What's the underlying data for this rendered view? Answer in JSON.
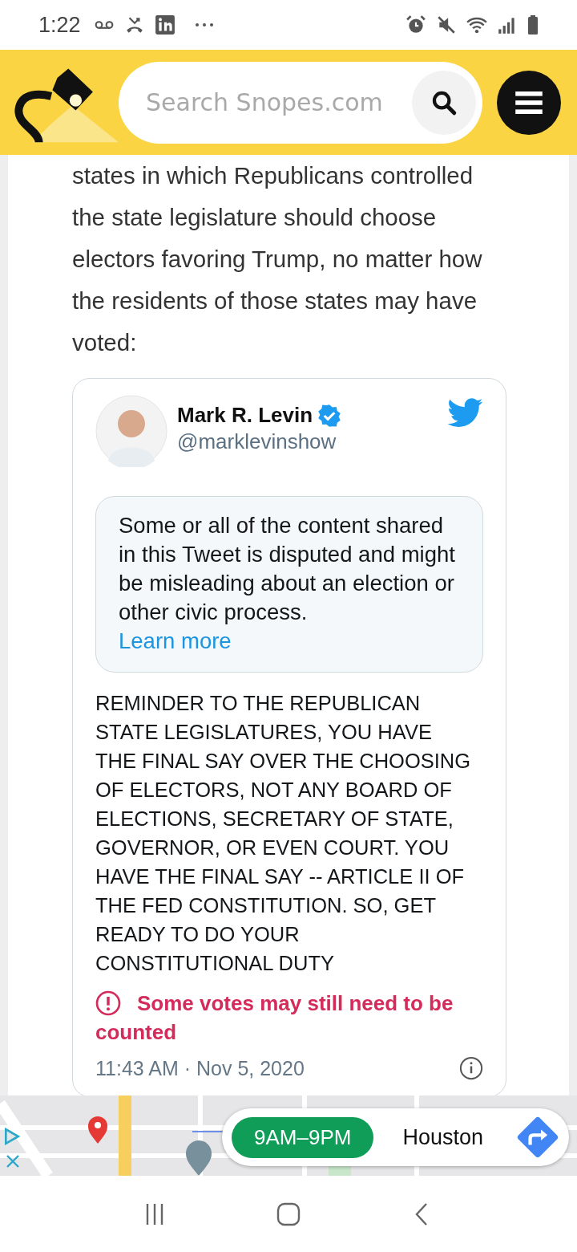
{
  "status_bar": {
    "time": "1:22"
  },
  "header": {
    "search": {
      "placeholder": "Search Snopes.com"
    }
  },
  "article": {
    "paragraph": "states in which Republicans controlled the state legislature should choose electors favoring Trump, no matter how the residents of those states may have voted:"
  },
  "tweet": {
    "author": "Mark R. Levin",
    "verified": true,
    "handle": "@marklevinshow",
    "notice": {
      "text": "Some or all of the content shared in this Tweet is disputed and might be misleading about an election or other civic process.",
      "link": "Learn more"
    },
    "text": "REMINDER TO THE REPUBLICAN STATE LEGISLATURES, YOU HAVE THE FINAL SAY OVER THE CHOOSING OF ELECTORS, NOT ANY BOARD OF ELECTIONS, SECRETARY OF STATE, GOVERNOR, OR EVEN COURT. YOU HAVE THE FINAL SAY -- ARTICLE II OF THE FED CONSTITUTION. SO, GET READY TO DO YOUR CONSTITUTIONAL DUTY",
    "warning": "Some votes may still need to be counted",
    "timestamp": "11:43 AM · Nov 5, 2020"
  },
  "ad": {
    "hours": "9AM–9PM",
    "location": "Houston"
  }
}
